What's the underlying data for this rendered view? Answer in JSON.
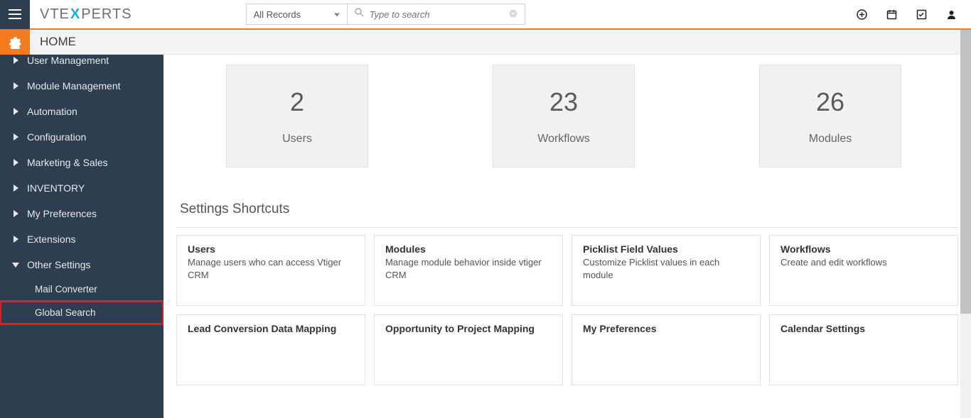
{
  "search": {
    "dropdown_label": "All Records",
    "placeholder": "Type to search"
  },
  "breadcrumb": "HOME",
  "sidebar": {
    "items": [
      {
        "label": "User Management",
        "expanded": false
      },
      {
        "label": "Module Management",
        "expanded": false
      },
      {
        "label": "Automation",
        "expanded": false
      },
      {
        "label": "Configuration",
        "expanded": false
      },
      {
        "label": "Marketing & Sales",
        "expanded": false
      },
      {
        "label": "INVENTORY",
        "expanded": false
      },
      {
        "label": "My Preferences",
        "expanded": false
      },
      {
        "label": "Extensions",
        "expanded": false
      },
      {
        "label": "Other Settings",
        "expanded": true,
        "children": [
          {
            "label": "Mail Converter"
          },
          {
            "label": "Global Search",
            "highlight": true
          }
        ]
      }
    ]
  },
  "stats": [
    {
      "value": "2",
      "label": "Users"
    },
    {
      "value": "23",
      "label": "Workflows"
    },
    {
      "value": "26",
      "label": "Modules"
    }
  ],
  "shortcuts_title": "Settings Shortcuts",
  "shortcuts": [
    {
      "title": "Users",
      "desc": "Manage users who can access Vtiger CRM"
    },
    {
      "title": "Modules",
      "desc": "Manage module behavior inside vtiger CRM"
    },
    {
      "title": "Picklist Field Values",
      "desc": "Customize Picklist values in each module"
    },
    {
      "title": "Workflows",
      "desc": "Create and edit workflows"
    },
    {
      "title": "Lead Conversion Data Mapping",
      "desc": ""
    },
    {
      "title": "Opportunity to Project Mapping",
      "desc": ""
    },
    {
      "title": "My Preferences",
      "desc": ""
    },
    {
      "title": "Calendar Settings",
      "desc": ""
    }
  ]
}
